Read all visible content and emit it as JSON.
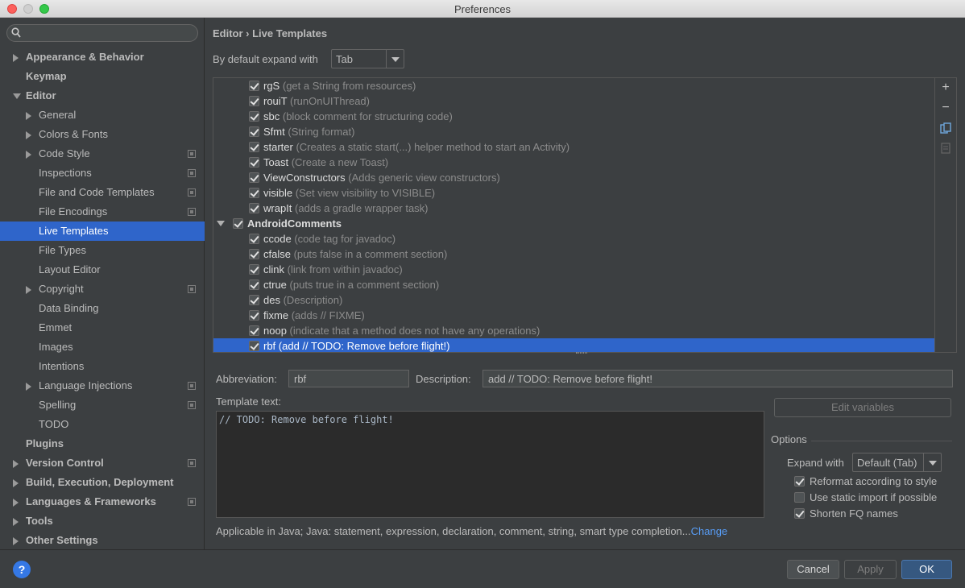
{
  "window": {
    "title": "Preferences"
  },
  "sidebar": {
    "search_placeholder": "",
    "items": [
      {
        "label": "Appearance & Behavior",
        "level": 0,
        "arrow": "right",
        "bold": true
      },
      {
        "label": "Keymap",
        "level": 0,
        "arrow": "none",
        "bold": true
      },
      {
        "label": "Editor",
        "level": 0,
        "arrow": "down",
        "bold": true
      },
      {
        "label": "General",
        "level": 1,
        "arrow": "right"
      },
      {
        "label": "Colors & Fonts",
        "level": 1,
        "arrow": "right"
      },
      {
        "label": "Code Style",
        "level": 1,
        "arrow": "right",
        "project": true
      },
      {
        "label": "Inspections",
        "level": 1,
        "arrow": "none",
        "project": true
      },
      {
        "label": "File and Code Templates",
        "level": 1,
        "arrow": "none",
        "project": true
      },
      {
        "label": "File Encodings",
        "level": 1,
        "arrow": "none",
        "project": true
      },
      {
        "label": "Live Templates",
        "level": 1,
        "arrow": "none",
        "selected": true
      },
      {
        "label": "File Types",
        "level": 1,
        "arrow": "none"
      },
      {
        "label": "Layout Editor",
        "level": 1,
        "arrow": "none"
      },
      {
        "label": "Copyright",
        "level": 1,
        "arrow": "right",
        "project": true
      },
      {
        "label": "Data Binding",
        "level": 1,
        "arrow": "none"
      },
      {
        "label": "Emmet",
        "level": 1,
        "arrow": "none"
      },
      {
        "label": "Images",
        "level": 1,
        "arrow": "none"
      },
      {
        "label": "Intentions",
        "level": 1,
        "arrow": "none"
      },
      {
        "label": "Language Injections",
        "level": 1,
        "arrow": "right",
        "project": true
      },
      {
        "label": "Spelling",
        "level": 1,
        "arrow": "none",
        "project": true
      },
      {
        "label": "TODO",
        "level": 1,
        "arrow": "none"
      },
      {
        "label": "Plugins",
        "level": 0,
        "arrow": "none",
        "bold": true
      },
      {
        "label": "Version Control",
        "level": 0,
        "arrow": "right",
        "bold": true,
        "project": true
      },
      {
        "label": "Build, Execution, Deployment",
        "level": 0,
        "arrow": "right",
        "bold": true
      },
      {
        "label": "Languages & Frameworks",
        "level": 0,
        "arrow": "right",
        "bold": true,
        "project": true
      },
      {
        "label": "Tools",
        "level": 0,
        "arrow": "right",
        "bold": true
      },
      {
        "label": "Other Settings",
        "level": 0,
        "arrow": "right",
        "bold": true
      }
    ]
  },
  "main": {
    "breadcrumb": "Editor › Live Templates",
    "expand_label": "By default expand with",
    "expand_value": "Tab",
    "templates": [
      {
        "abbr": "rgS",
        "desc": "(get a String from resources)",
        "checked": true
      },
      {
        "abbr": "rouiT",
        "desc": "(runOnUIThread)",
        "checked": true
      },
      {
        "abbr": "sbc",
        "desc": "(block comment for structuring code)",
        "checked": true
      },
      {
        "abbr": "Sfmt",
        "desc": "(String format)",
        "checked": true
      },
      {
        "abbr": "starter",
        "desc": "(Creates a static start(...) helper method to start an Activity)",
        "checked": true
      },
      {
        "abbr": "Toast",
        "desc": "(Create a new Toast)",
        "checked": true
      },
      {
        "abbr": "ViewConstructors",
        "desc": "(Adds generic view constructors)",
        "checked": true
      },
      {
        "abbr": "visible",
        "desc": "(Set view visibility to VISIBLE)",
        "checked": true
      },
      {
        "abbr": "wrapIt",
        "desc": "(adds a gradle wrapper task)",
        "checked": true
      },
      {
        "abbr": "AndroidComments",
        "desc": "",
        "checked": true,
        "group": true
      },
      {
        "abbr": "ccode",
        "desc": "(code tag for javadoc)",
        "checked": true
      },
      {
        "abbr": "cfalse",
        "desc": "(puts false in a comment section)",
        "checked": true
      },
      {
        "abbr": "clink",
        "desc": "(link from within javadoc)",
        "checked": true
      },
      {
        "abbr": "ctrue",
        "desc": "(puts true in a comment section)",
        "checked": true
      },
      {
        "abbr": "des",
        "desc": "(Description)",
        "checked": true
      },
      {
        "abbr": "fixme",
        "desc": "(adds // FIXME)",
        "checked": true
      },
      {
        "abbr": "noop",
        "desc": "(indicate that a method does not have any operations)",
        "checked": true
      },
      {
        "abbr": "rbf",
        "desc": "(add // TODO: Remove before flight!)",
        "checked": true,
        "selected": true
      }
    ],
    "tools": {
      "add": "+",
      "remove": "−"
    },
    "abbreviation_label": "Abbreviation:",
    "abbreviation_value": "rbf",
    "description_label": "Description:",
    "description_value": "add // TODO: Remove before flight!",
    "template_text_label": "Template text:",
    "template_text": "// TODO: Remove before flight!",
    "edit_variables_label": "Edit variables",
    "options_title": "Options",
    "options_expand_label": "Expand with",
    "options_expand_value": "Default (Tab)",
    "options": [
      {
        "label": "Reformat according to style",
        "checked": true
      },
      {
        "label": "Use static import if possible",
        "checked": false
      },
      {
        "label": "Shorten FQ names",
        "checked": true
      }
    ],
    "applicable_text": "Applicable in Java; Java: statement, expression, declaration, comment, string, smart type completion...",
    "change_link": "Change"
  },
  "footer": {
    "help": "?",
    "cancel": "Cancel",
    "apply": "Apply",
    "ok": "OK"
  },
  "colors": {
    "selection": "#2f65ca",
    "background": "#3c3f41",
    "link": "#589df6"
  }
}
